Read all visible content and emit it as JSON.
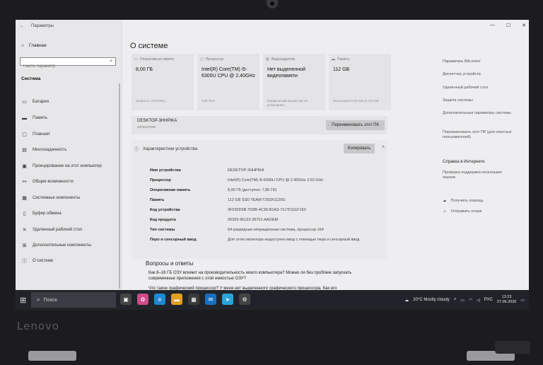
{
  "window": {
    "title": "Параметры",
    "back_icon": "arrow-left-icon",
    "controls": [
      "—",
      "☐",
      "✕"
    ]
  },
  "sidebar": {
    "home_label": "Главная",
    "search_placeholder": "Найти параметр",
    "section_label": "Система",
    "items": [
      {
        "label": "Батарея",
        "icon": "battery-icon"
      },
      {
        "label": "Память",
        "icon": "storage-icon"
      },
      {
        "label": "Планшет",
        "icon": "tablet-icon"
      },
      {
        "label": "Многозадачность",
        "icon": "multitask-icon"
      },
      {
        "label": "Проецирование на этот компьютер",
        "icon": "project-icon"
      },
      {
        "label": "Общие возможности",
        "icon": "shared-icon"
      },
      {
        "label": "Системные компоненты",
        "icon": "components-icon"
      },
      {
        "label": "Буфер обмена",
        "icon": "clipboard-icon"
      },
      {
        "label": "Удаленный рабочий стол",
        "icon": "remote-icon"
      },
      {
        "label": "Дополнительные компоненты",
        "icon": "extras-icon"
      },
      {
        "label": "О системе",
        "icon": "info-icon"
      }
    ]
  },
  "main": {
    "title": "О системе",
    "cards": [
      {
        "header": "Оперативная память",
        "value": "8,00 ГБ",
        "footer": "Скорость: 2133 МГц"
      },
      {
        "header": "Процессор",
        "value": "Intel(R) Core(TM) i5-6300U CPU @ 2.40GHz",
        "footer": "2.50 GHz"
      },
      {
        "header": "Видеоадаптер",
        "value": "Нет выделенной видеопамяти",
        "footer": "Графический процессор не установлен"
      },
      {
        "header": "Память",
        "value": "112 GB",
        "footer": "Используется 52 GB из 112 GB"
      }
    ],
    "pc_name": "DESKTOP-3HHPIKA",
    "pc_model": "20F5S1F000",
    "rename_label": "Переименовать этот ПК",
    "specs_title": "Характеристики устройства",
    "copy_label": "Копировать",
    "specs": [
      {
        "key": "Имя устройства",
        "value": "DESKTOP-3HHPIKA"
      },
      {
        "key": "Процессор",
        "value": "Intel(R) Core(TM) i5-6300U CPU @ 2.40GHz   2.50 GHz"
      },
      {
        "key": "Оперативная память",
        "value": "8,00 ГБ (доступно: 7,86 ГБ)"
      },
      {
        "key": "Память",
        "value": "112 GB SSD TEAM T253X1120G"
      },
      {
        "key": "Код устройства",
        "value": "3F035D5B-7D0B-4C39-B1A3-7117D111F160"
      },
      {
        "key": "Код продукта",
        "value": "00325-96122-39751-AAOEM"
      },
      {
        "key": "Тип системы",
        "value": "64-разрядная операционная система, процессор x64"
      },
      {
        "key": "Перо и сенсорный ввод",
        "value": "Для этого монитора недоступен ввод с помощью пера и сенсорный ввод"
      }
    ],
    "faq_title": "Вопросы и ответы",
    "faq": [
      "Как 8–16 ГБ ОЗУ влияют на производительность моего компьютера? Можно ли без проблем запускать современные приложения с этой емкостью ОЗУ?",
      "Что такое графический процессор? У меня нет выделенного графического процессора. Как его"
    ]
  },
  "right": {
    "links": [
      "Параметры BitLocker",
      "Диспетчер устройств",
      "Удаленный рабочий стол",
      "Защита системы",
      "Дополнительные параметры системы",
      "Переименовать этот ПК (для опытных пользователей)"
    ],
    "help_title": "Справка в Интернете",
    "help_link": "Проверка поддержки нескольких языков",
    "get_help": "Получить помощь",
    "feedback": "Отправить отзыв"
  },
  "taskbar": {
    "search_label": "Поиск",
    "weather": "20°C  Mostly cloudy",
    "lang": "РУС",
    "time": "13:23",
    "date": "27.06.2026"
  },
  "bezel_logo": "Lenovo"
}
